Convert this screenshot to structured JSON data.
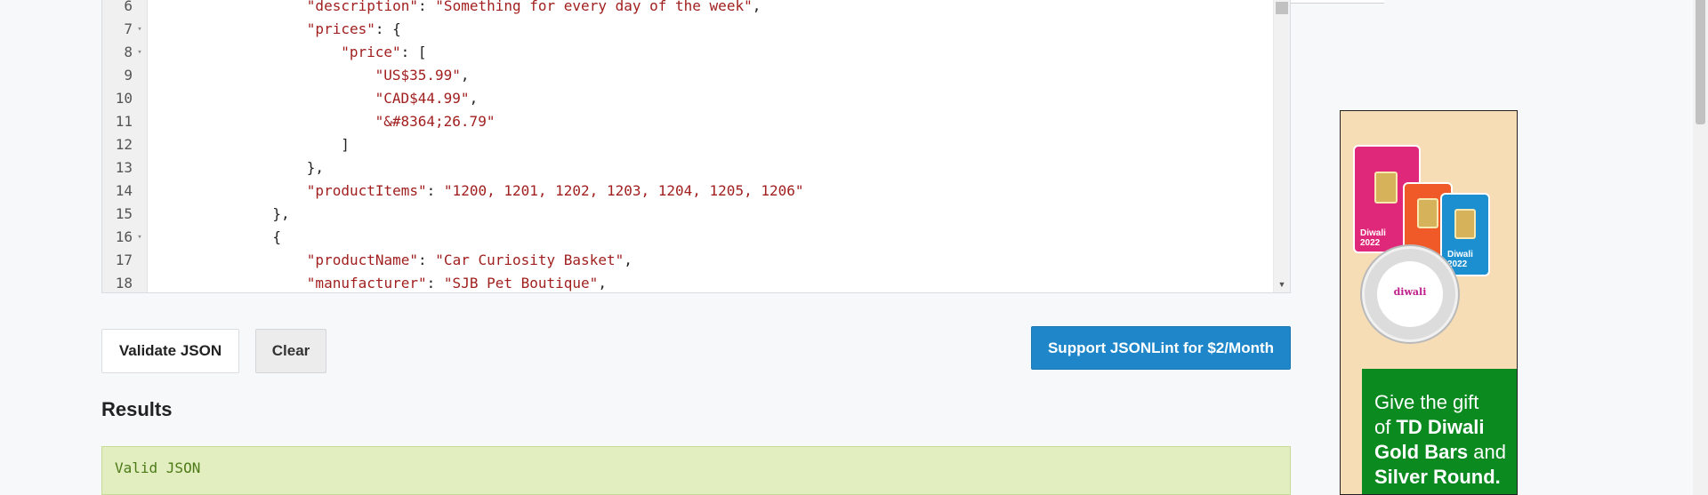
{
  "editor": {
    "lines": [
      {
        "num": "6",
        "fold": "",
        "indent": 8,
        "parts": [
          {
            "t": "\"description\"",
            "c": "k"
          },
          {
            "t": ": ",
            "c": "p"
          },
          {
            "t": "\"Something for every day of the week\"",
            "c": "s"
          },
          {
            "t": ",",
            "c": "p"
          }
        ]
      },
      {
        "num": "7",
        "fold": "▾",
        "indent": 8,
        "parts": [
          {
            "t": "\"prices\"",
            "c": "k"
          },
          {
            "t": ": {",
            "c": "p"
          }
        ]
      },
      {
        "num": "8",
        "fold": "▾",
        "indent": 12,
        "parts": [
          {
            "t": "\"price\"",
            "c": "k"
          },
          {
            "t": ": [",
            "c": "p"
          }
        ]
      },
      {
        "num": "9",
        "fold": "",
        "indent": 16,
        "parts": [
          {
            "t": "\"US$35.99\"",
            "c": "s"
          },
          {
            "t": ",",
            "c": "p"
          }
        ]
      },
      {
        "num": "10",
        "fold": "",
        "indent": 16,
        "parts": [
          {
            "t": "\"CAD$44.99\"",
            "c": "s"
          },
          {
            "t": ",",
            "c": "p"
          }
        ]
      },
      {
        "num": "11",
        "fold": "",
        "indent": 16,
        "parts": [
          {
            "t": "\"&#8364;26.79\"",
            "c": "s"
          }
        ]
      },
      {
        "num": "12",
        "fold": "",
        "indent": 12,
        "parts": [
          {
            "t": "]",
            "c": "p"
          }
        ]
      },
      {
        "num": "13",
        "fold": "",
        "indent": 8,
        "parts": [
          {
            "t": "},",
            "c": "p"
          }
        ]
      },
      {
        "num": "14",
        "fold": "",
        "indent": 8,
        "parts": [
          {
            "t": "\"productItems\"",
            "c": "k"
          },
          {
            "t": ": ",
            "c": "p"
          },
          {
            "t": "\"1200, 1201, 1202, 1203, 1204, 1205, 1206\"",
            "c": "s"
          }
        ]
      },
      {
        "num": "15",
        "fold": "",
        "indent": 4,
        "parts": [
          {
            "t": "},",
            "c": "p"
          }
        ]
      },
      {
        "num": "16",
        "fold": "▾",
        "indent": 4,
        "parts": [
          {
            "t": "{",
            "c": "p"
          }
        ]
      },
      {
        "num": "17",
        "fold": "",
        "indent": 8,
        "parts": [
          {
            "t": "\"productName\"",
            "c": "k"
          },
          {
            "t": ": ",
            "c": "p"
          },
          {
            "t": "\"Car Curiosity Basket\"",
            "c": "s"
          },
          {
            "t": ",",
            "c": "p"
          }
        ]
      },
      {
        "num": "18",
        "fold": "",
        "indent": 8,
        "parts": [
          {
            "t": "\"manufacturer\"",
            "c": "k"
          },
          {
            "t": ": ",
            "c": "p"
          },
          {
            "t": "\"SJB Pet Boutique\"",
            "c": "s"
          },
          {
            "t": ",",
            "c": "p"
          }
        ]
      }
    ]
  },
  "buttons": {
    "validate": "Validate JSON",
    "clear": "Clear",
    "support": "Support JSONLint for $2/Month"
  },
  "results": {
    "title": "Results",
    "message": "Valid JSON"
  },
  "ad": {
    "card_label_1": "Diwali 2022",
    "card_label_2": "Diwali 2022",
    "coin_text": "diwali",
    "tagline_line1": "Give the gift",
    "tagline_line2_pre": "of ",
    "tagline_line2_bold": "TD Diwali",
    "tagline_line3_bold": "Gold Bars",
    "tagline_line3_post": " and",
    "tagline_line4_bold": "Silver Round."
  },
  "colors": {
    "key": "#a11f1f",
    "string": "#a11f1f",
    "support_button": "#1f87c9",
    "valid_bg": "#e3eec0",
    "valid_text": "#4b7a16",
    "ad_green": "#0a8a1f"
  }
}
